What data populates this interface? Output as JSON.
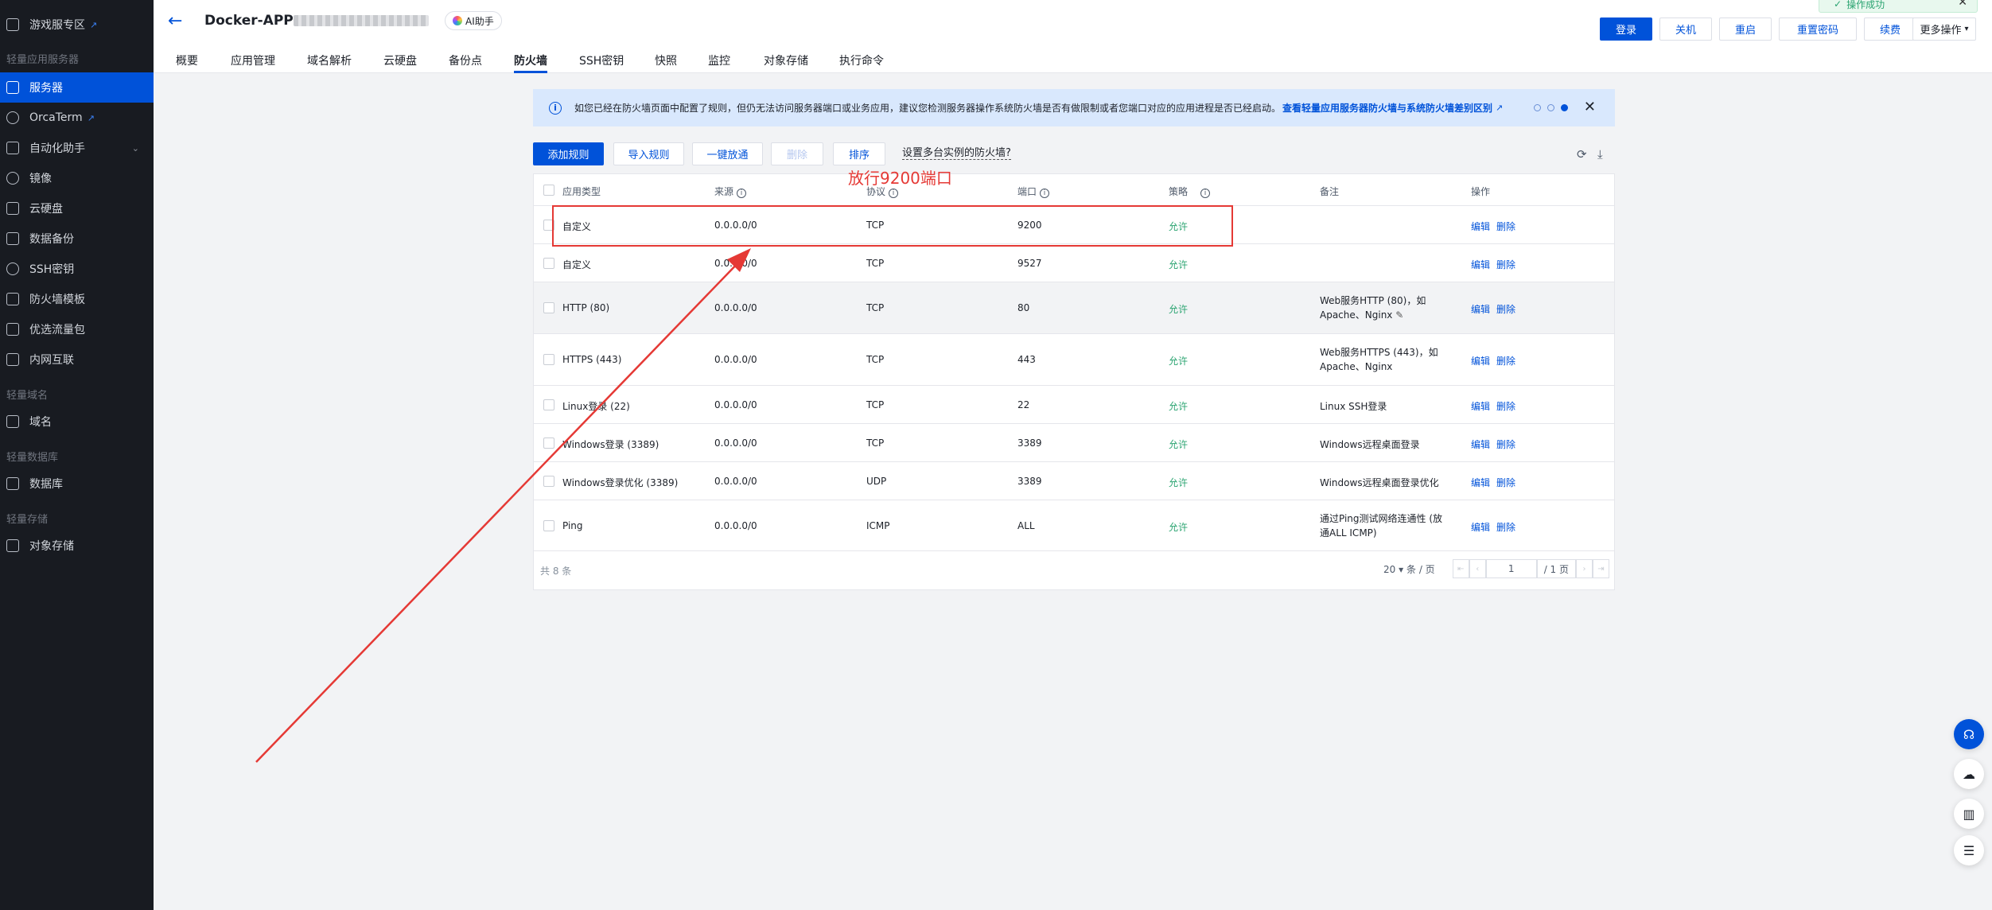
{
  "sidebar": {
    "items": [
      {
        "label": "游戏服专区",
        "external": true
      },
      {
        "label": "服务器",
        "active": true
      },
      {
        "label": "OrcaTerm",
        "external": true
      },
      {
        "label": "自动化助手",
        "expandable": true
      },
      {
        "label": "镜像"
      },
      {
        "label": "云硬盘"
      },
      {
        "label": "数据备份"
      },
      {
        "label": "SSH密钥"
      },
      {
        "label": "防火墙模板"
      },
      {
        "label": "优选流量包"
      },
      {
        "label": "内网互联"
      },
      {
        "label": "域名"
      },
      {
        "label": "数据库"
      },
      {
        "label": "对象存储"
      }
    ],
    "groups": [
      "轻量应用服务器",
      "轻量域名",
      "轻量数据库",
      "轻量存储"
    ]
  },
  "header": {
    "title": "Docker-APP",
    "ai_label": "AI助手",
    "tabs": [
      "概要",
      "应用管理",
      "域名解析",
      "云硬盘",
      "备份点",
      "防火墙",
      "SSH密钥",
      "快照",
      "监控",
      "对象存储",
      "执行命令"
    ],
    "active_tab": "防火墙",
    "actions": [
      "登录",
      "关机",
      "重启",
      "重置密码",
      "续费",
      "更多操作"
    ],
    "toast": "操作成功"
  },
  "notice": {
    "text": "如您已经在防火墙页面中配置了规则，但仍无法访问服务器端口或业务应用，建议您检测服务器操作系统防火墙是否有做限制或者您端口对应的应用进程是否已经启动。",
    "link": "查看轻量应用服务器防火墙与系统防火墙差别区别"
  },
  "toolbar": {
    "add": "添加规则",
    "import": "导入规则",
    "open_all": "一键放通",
    "delete": "删除",
    "sort": "排序",
    "multi": "设置多台实例的防火墙?"
  },
  "table": {
    "headers": [
      "应用类型",
      "来源",
      "协议",
      "端口",
      "策略",
      "备注",
      "操作"
    ],
    "rows": [
      {
        "type": "自定义",
        "source": "0.0.0.0/0",
        "protocol": "TCP",
        "port": "9200",
        "policy": "允许",
        "note": ""
      },
      {
        "type": "自定义",
        "source": "0.0.0.0/0",
        "protocol": "TCP",
        "port": "9527",
        "policy": "允许",
        "note": ""
      },
      {
        "type": "HTTP (80)",
        "source": "0.0.0.0/0",
        "protocol": "TCP",
        "port": "80",
        "policy": "允许",
        "note": "Web服务HTTP (80)，如Apache、Nginx"
      },
      {
        "type": "HTTPS (443)",
        "source": "0.0.0.0/0",
        "protocol": "TCP",
        "port": "443",
        "policy": "允许",
        "note": "Web服务HTTPS (443)，如Apache、Nginx"
      },
      {
        "type": "Linux登录 (22)",
        "source": "0.0.0.0/0",
        "protocol": "TCP",
        "port": "22",
        "policy": "允许",
        "note": "Linux SSH登录"
      },
      {
        "type": "Windows登录 (3389)",
        "source": "0.0.0.0/0",
        "protocol": "TCP",
        "port": "3389",
        "policy": "允许",
        "note": "Windows远程桌面登录"
      },
      {
        "type": "Windows登录优化 (3389)",
        "source": "0.0.0.0/0",
        "protocol": "UDP",
        "port": "3389",
        "policy": "允许",
        "note": "Windows远程桌面登录优化"
      },
      {
        "type": "Ping",
        "source": "0.0.0.0/0",
        "protocol": "ICMP",
        "port": "ALL",
        "policy": "允许",
        "note": "通过Ping测试网络连通性 (放通ALL ICMP)"
      }
    ],
    "edit_label": "编辑",
    "delete_label": "删除",
    "total": "共 8 条",
    "page_size": "20",
    "page_size_unit": "条 / 页",
    "page": "1",
    "page_total": "/ 1 页"
  },
  "annotation": {
    "text": "放行9200端口"
  }
}
